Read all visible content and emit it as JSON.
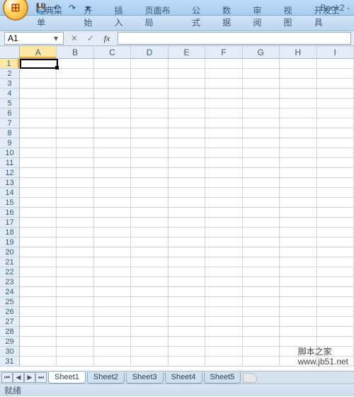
{
  "window": {
    "title": "Book2 -"
  },
  "qat": {
    "save": "💾",
    "undo": "↶",
    "redo": "↷",
    "dd": "▾"
  },
  "tabs": [
    "经典菜单",
    "开始",
    "插入",
    "页面布局",
    "公式",
    "数据",
    "审阅",
    "视图",
    "开发工具"
  ],
  "namebox": {
    "value": "A1",
    "dd": "▾"
  },
  "fx": {
    "cancel": "✕",
    "enter": "✓",
    "label": "fx"
  },
  "columns": [
    "A",
    "B",
    "C",
    "D",
    "E",
    "F",
    "G",
    "H",
    "I"
  ],
  "rows": [
    "1",
    "2",
    "3",
    "4",
    "5",
    "6",
    "7",
    "8",
    "9",
    "10",
    "11",
    "12",
    "13",
    "14",
    "15",
    "16",
    "17",
    "18",
    "19",
    "20",
    "21",
    "22",
    "23",
    "24",
    "25",
    "26",
    "27",
    "28",
    "29",
    "30",
    "31"
  ],
  "nav": {
    "first": "⏮",
    "prev": "◀",
    "next": "▶",
    "last": "⏭"
  },
  "sheets": [
    "Sheet1",
    "Sheet2",
    "Sheet3",
    "Sheet4",
    "Sheet5"
  ],
  "status": "就绪",
  "watermark": {
    "main": "脚本之家",
    "url": "www.jb51.net"
  }
}
